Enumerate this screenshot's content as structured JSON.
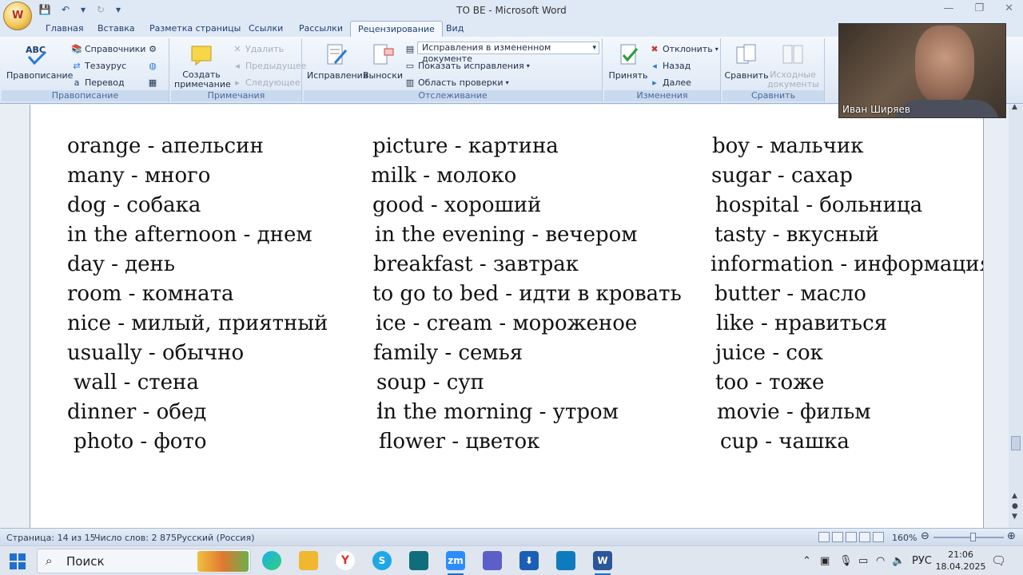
{
  "window": {
    "title": "TO BE - Microsoft Word",
    "office_button_letter": "W"
  },
  "tabs": [
    {
      "label": "Главная"
    },
    {
      "label": "Вставка"
    },
    {
      "label": "Разметка страницы"
    },
    {
      "label": "Ссылки"
    },
    {
      "label": "Рассылки"
    },
    {
      "label": "Рецензирование",
      "active": true
    },
    {
      "label": "Вид"
    }
  ],
  "ribbon": {
    "proofing": {
      "label": "Правописание",
      "spelling": "Правописание",
      "spelling_icon_text": "ABC",
      "research": "Справочники",
      "thesaurus": "Тезаурус",
      "translate": "Перевод"
    },
    "comments": {
      "label": "Примечания",
      "new_comment": "Создать примечание",
      "delete": "Удалить",
      "previous": "Предыдущее",
      "next": "Следующее"
    },
    "tracking": {
      "label": "Отслеживание",
      "track_changes": "Исправления",
      "balloons": "Выноски",
      "display_mode": "Исправления в измененном документе",
      "show_markup": "Показать исправления",
      "reviewing_pane": "Область проверки"
    },
    "changes": {
      "label": "Изменения",
      "accept": "Принять",
      "reject": "Отклонить",
      "previous": "Назад",
      "next": "Далее"
    },
    "compare": {
      "label": "Сравнить",
      "compare": "Сравнить",
      "source_docs": "Исходные документы"
    }
  },
  "video": {
    "participant_name": "Иван Ширяев"
  },
  "document": {
    "columns": [
      [
        "orange - апельсин",
        "many - много",
        "dog - собака",
        "in the afternoon - днем",
        "day - день",
        "room - комната",
        "nice - милый, приятный",
        "usually - обычно",
        "wall -  стена",
        "dinner - обед",
        "photo - фото"
      ],
      [
        "picture - картина",
        "milk -  молоко",
        "good - хороший",
        "in the evening - вечером",
        "breakfast - завтрак",
        "to go to bed - идти в кровать",
        "ice - cream - мороженое",
        "family -  семья",
        "soup - суп",
        "in the morning - утром",
        "flower - цветок"
      ],
      [
        "boy - мальчик",
        "sugar - сахар",
        "hospital - больница",
        "tasty - вкусный",
        "information - информация",
        "butter - масло",
        "like - нравиться",
        "juice - сок",
        "too - тоже",
        "movie - фильм",
        "cup - чашка"
      ]
    ]
  },
  "statusbar": {
    "page": "Страница: 14 из 15",
    "word_count": "Число слов: 2 875",
    "language": "Русский (Россия)",
    "zoom": "160%"
  },
  "taskbar": {
    "search_placeholder": "Поиск",
    "language": "РУС",
    "time": "21:06",
    "date": "18.04.2025"
  }
}
